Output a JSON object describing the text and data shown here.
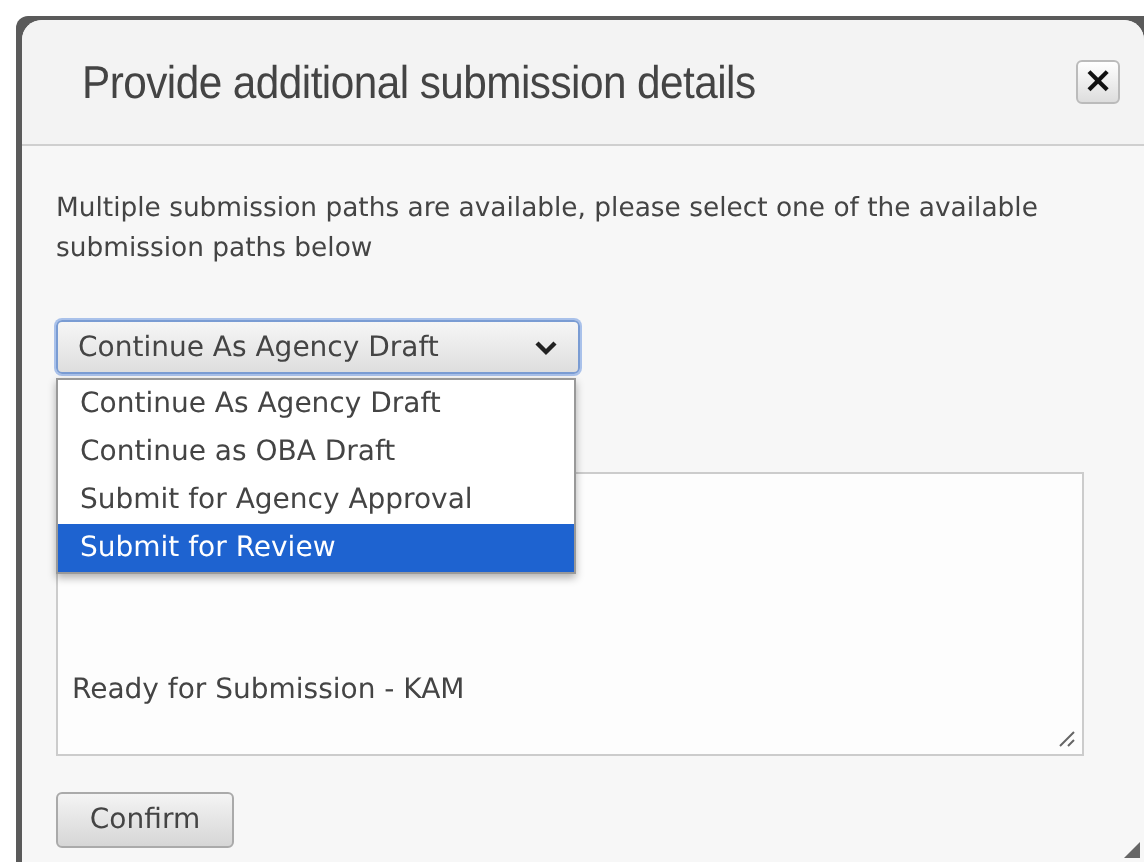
{
  "dialog": {
    "title": "Provide additional submission details",
    "close": "×",
    "message": "Multiple submission paths are available, please select one of the available submission paths below",
    "select": {
      "value": "Continue As Agency Draft",
      "expanded": true,
      "options": [
        {
          "label": "Continue As Agency Draft",
          "highlighted": false
        },
        {
          "label": "Continue as OBA Draft",
          "highlighted": false
        },
        {
          "label": "Submit for Agency Approval",
          "highlighted": false
        },
        {
          "label": "Submit for Review",
          "highlighted": true
        }
      ]
    },
    "comments": {
      "value": "Ready for Submission - KAM"
    },
    "buttons": [
      "Confirm"
    ]
  }
}
